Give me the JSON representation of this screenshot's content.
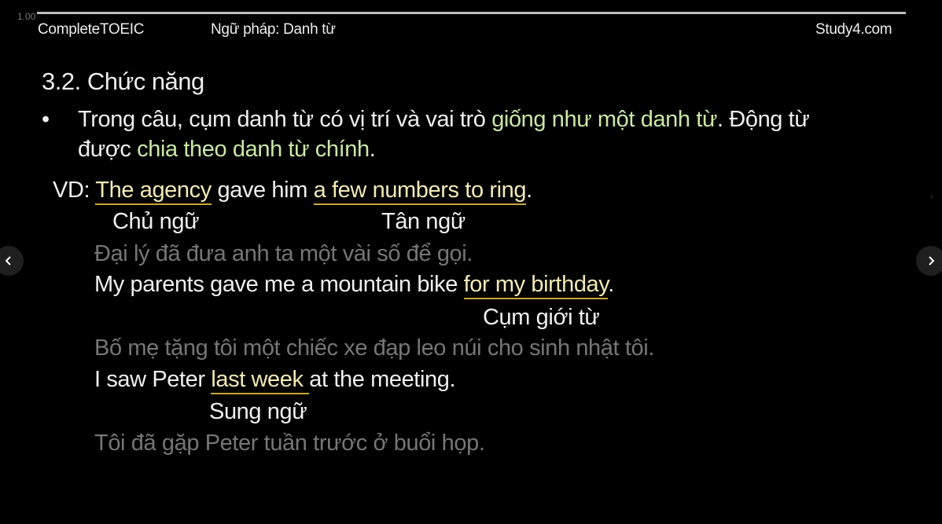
{
  "player": {
    "speed_label": "1.00"
  },
  "header": {
    "course": "CompleteTOEIC",
    "lesson": "Ngữ pháp: Danh từ",
    "brand": "Study4.com"
  },
  "slide": {
    "heading": "3.2. Chức năng",
    "bullet": {
      "marker": "•",
      "part1": "Trong câu, cụm danh từ có vị trí và vai trò ",
      "highlight1": "giống như một danh từ",
      "part2": ". Động từ",
      "part3": "được ",
      "highlight2": "chia theo danh từ chính",
      "part4": "."
    },
    "example1": {
      "prefix": "VD: ",
      "subject": "The agency",
      "middle": " gave him ",
      "object": "a few numbers to ring",
      "end": ".",
      "label_subject": "Chủ ngữ",
      "label_object": "Tân ngữ",
      "translation": "Đại lý đã đưa anh ta một vài số để gọi."
    },
    "example2": {
      "start": "My parents gave me a mountain bike ",
      "phrase": "for my birthday",
      "end": ".",
      "label": "Cụm giới từ",
      "translation": "Bố mẹ tặng tôi một chiếc xe đạp leo núi cho sinh nhật tôi."
    },
    "example3": {
      "start": "I saw Peter ",
      "phrase": "last week ",
      "end": "at the meeting.",
      "label": "Sung ngữ",
      "translation": "Tôi đã gặp Peter tuần trước ở buổi họp."
    }
  },
  "nav": {
    "prev_icon": "chevron-left-icon",
    "next_icon": "chevron-right-icon"
  },
  "colors": {
    "background": "#000000",
    "text": "#efefef",
    "highlight_green": "#c9e8a8",
    "underline_gold": "#c9a73a",
    "translation_gray": "#767676"
  }
}
